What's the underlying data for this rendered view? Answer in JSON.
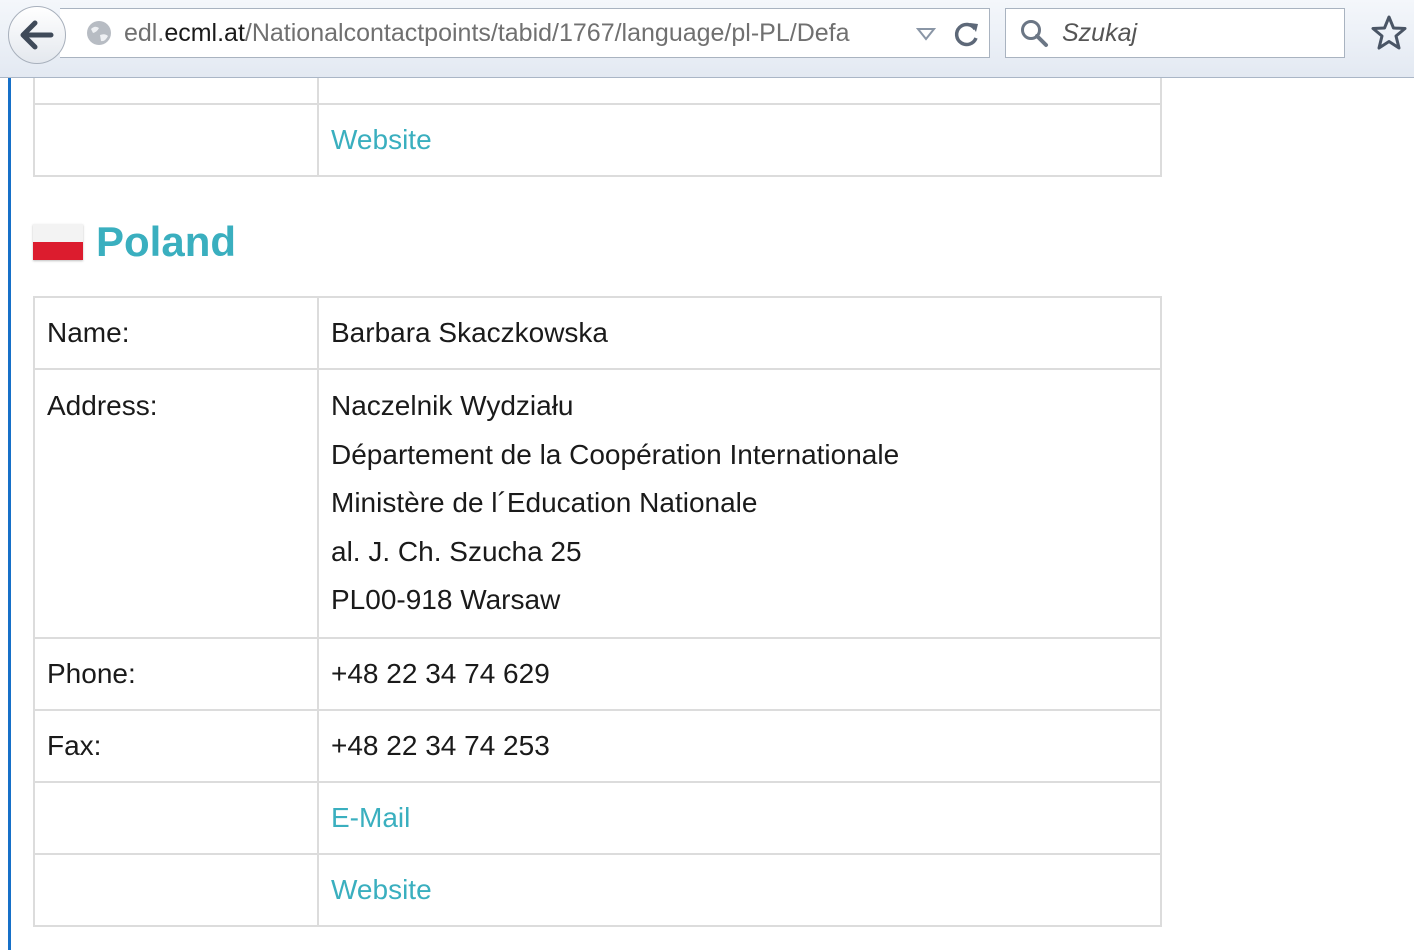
{
  "browser": {
    "url_prefix": "edl.",
    "url_domain": "ecml.at",
    "url_path": "/Nationalcontactpoints/tabid/1767/language/pl-PL/Defa",
    "search_placeholder": "Szukaj"
  },
  "icons": {
    "back": "back-arrow-icon",
    "site": "globe-icon",
    "dropdown": "dropdown-arrow-icon",
    "reload": "reload-icon",
    "search": "search-icon",
    "bookmark": "star-icon"
  },
  "colors": {
    "link": "#3aafbf",
    "flag_red": "#dc1c2e",
    "flag_white": "#f3f3f3",
    "accent_edge": "#1670c8"
  },
  "previous_entry": {
    "website_label": "Website"
  },
  "poland": {
    "country": "Poland",
    "name_label": "Name:",
    "name_value": "Barbara Skaczkowska",
    "address_label": "Address:",
    "address_lines": [
      "Naczelnik Wydziału",
      "Département de la Coopération Internationale",
      "Ministère de l´Education Nationale",
      "al. J. Ch. Szucha 25",
      "PL00-918 Warsaw"
    ],
    "phone_label": "Phone:",
    "phone_value": "+48 22 34 74 629",
    "fax_label": "Fax:",
    "fax_value": "+48 22 34 74 253",
    "email_label": "E-Mail",
    "website_label": "Website"
  }
}
